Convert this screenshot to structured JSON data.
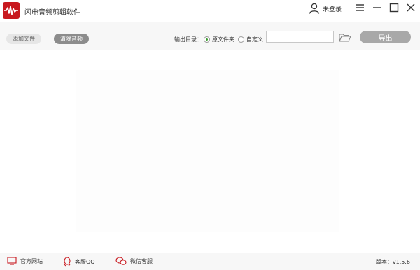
{
  "titlebar": {
    "app_title": "闪电音频剪辑软件",
    "logo_icon": "audio-waveform-icon",
    "login_label": "未登录",
    "menu_icon": "menu-icon",
    "minimize_icon": "minimize-icon",
    "maximize_icon": "maximize-icon",
    "close_icon": "close-icon"
  },
  "toolbar": {
    "add_file_label": "添加文件",
    "clear_audio_label": "清除音频",
    "output_dir_label": "输出目录：",
    "option_original": "原文件夹",
    "option_custom": "自定义",
    "selected_option": "原文件夹",
    "path_value": "",
    "export_label": "导出"
  },
  "statusbar": {
    "website_label": "官方网站",
    "qq_label": "客服QQ",
    "wechat_label": "微信客服",
    "version_label": "版本：v1.5.6"
  },
  "colors": {
    "brand": "#c8191f",
    "radio_checked": "#3c9b2f",
    "export_button": "#a8a8a8",
    "clear_button": "#8c8c8c"
  }
}
